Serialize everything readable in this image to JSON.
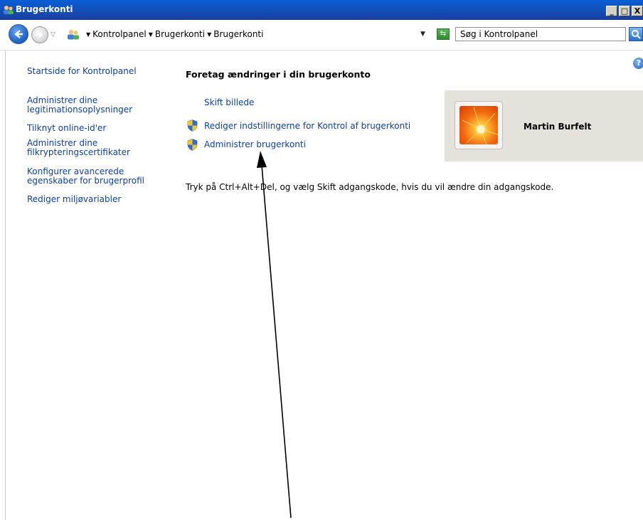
{
  "window": {
    "title": "Brugerkonti",
    "minimize_label": "_",
    "maximize_label": "□",
    "close_label": "X"
  },
  "navigation": {
    "breadcrumbs": [
      "Kontrolpanel",
      "Brugerkonti",
      "Brugerkonti"
    ],
    "search_placeholder": "Søg i Kontrolpanel"
  },
  "sidebar": {
    "items": [
      {
        "label": "Startside for Kontrolpanel"
      },
      {
        "label_line1": "Administrer dine",
        "label_line2": "legitimationsoplysninger"
      },
      {
        "label": "Tilknyt online-id'er"
      },
      {
        "label_line1": "Administrer dine",
        "label_line2": "filkrypteringscertifikater"
      },
      {
        "label_line1": "Konfigurer avancerede",
        "label_line2": "egenskaber for brugerprofil"
      },
      {
        "label": "Rediger miljøvariabler"
      }
    ]
  },
  "main": {
    "heading": "Foretag ændringer i din brugerkonto",
    "tasks": [
      {
        "label": "Skift billede",
        "icon": "none"
      },
      {
        "label": "Rediger indstillingerne for Kontrol af brugerkonti",
        "icon": "uac-shield-icon"
      },
      {
        "label": "Administrer brugerkonti",
        "icon": "uac-shield-icon"
      }
    ],
    "hint": "Tryk på Ctrl+Alt+Del, og vælg Skift adgangskode, hvis du vil ændre din adgangskode."
  },
  "user": {
    "name": "Martin Burfelt"
  },
  "colors": {
    "link": "#0b3fa7",
    "titlebar": "#0a5fd6",
    "user_card_bg": "#e5e1db"
  }
}
